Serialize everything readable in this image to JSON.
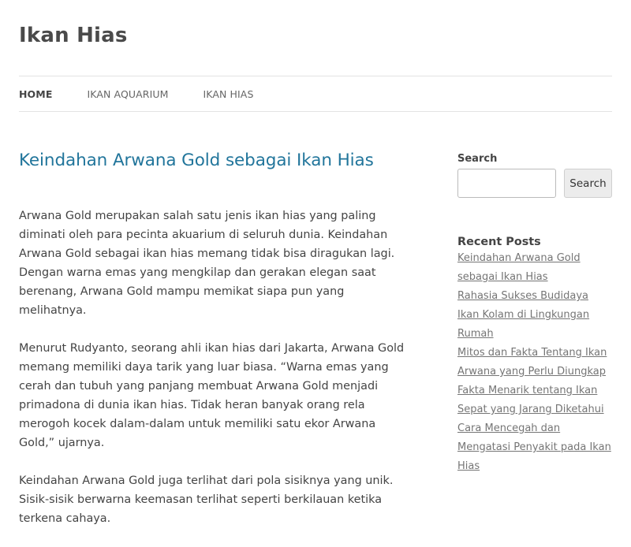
{
  "site": {
    "title": "Ikan Hias"
  },
  "nav": {
    "items": [
      {
        "label": "HOME"
      },
      {
        "label": "IKAN AQUARIUM"
      },
      {
        "label": "IKAN HIAS"
      }
    ]
  },
  "post": {
    "title": "Keindahan Arwana Gold sebagai Ikan Hias",
    "paragraphs": [
      "Arwana Gold merupakan salah satu jenis ikan hias yang paling diminati oleh para pecinta akuarium di seluruh dunia. Keindahan Arwana Gold sebagai ikan hias memang tidak bisa diragukan lagi. Dengan warna emas yang mengkilap dan gerakan elegan saat berenang, Arwana Gold mampu memikat siapa pun yang melihatnya.",
      "Menurut Rudyanto, seorang ahli ikan hias dari Jakarta, Arwana Gold memang memiliki daya tarik yang luar biasa. “Warna emas yang cerah dan tubuh yang panjang membuat Arwana Gold menjadi primadona di dunia ikan hias. Tidak heran banyak orang rela merogoh kocek dalam-dalam untuk memiliki satu ekor Arwana Gold,” ujarnya.",
      "Keindahan Arwana Gold juga terlihat dari pola sisiknya yang unik. Sisik-sisik berwarna keemasan terlihat seperti berkilauan ketika terkena cahaya."
    ]
  },
  "sidebar": {
    "search_label": "Search",
    "search_placeholder": "",
    "search_button": "Search",
    "recent_title": "Recent Posts",
    "recent_posts": [
      {
        "title": "Keindahan Arwana Gold sebagai Ikan Hias"
      },
      {
        "title": "Rahasia Sukses Budidaya Ikan Kolam di Lingkungan Rumah"
      },
      {
        "title": "Mitos dan Fakta Tentang Ikan Arwana yang Perlu Diungkap"
      },
      {
        "title": "Fakta Menarik tentang Ikan Sepat yang Jarang Diketahui"
      },
      {
        "title": "Cara Mencegah dan Mengatasi Penyakit pada Ikan Hias"
      }
    ]
  },
  "colors": {
    "link_title": "#21759b",
    "text": "#444444",
    "recent_link": "#757575"
  }
}
